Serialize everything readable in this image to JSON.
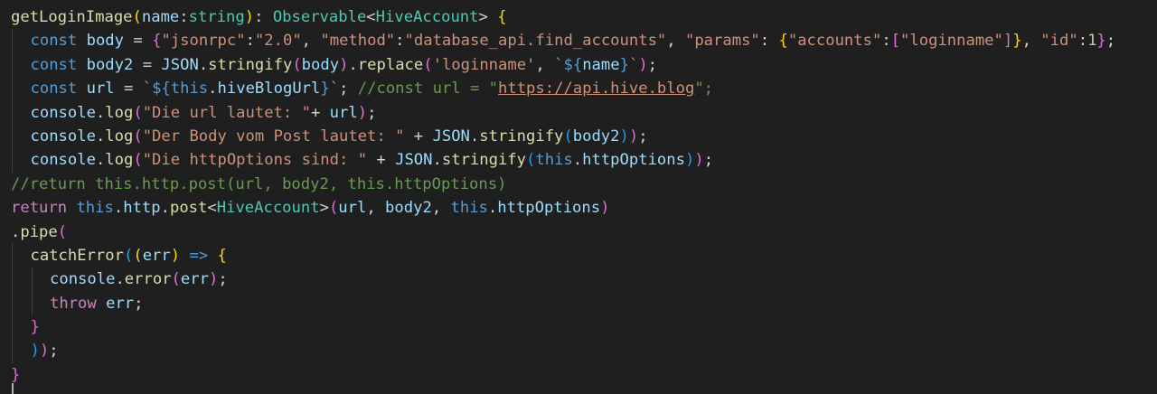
{
  "editor": {
    "language": "TypeScript",
    "theme": "dark",
    "lines": [
      {
        "indent": 0,
        "tokens": [
          {
            "text": "getLoginImage",
            "kind": "function"
          },
          {
            "text": "(",
            "kind": "bracket1"
          },
          {
            "text": "name",
            "kind": "variable"
          },
          {
            "text": ":",
            "kind": "default"
          },
          {
            "text": "string",
            "kind": "type"
          },
          {
            "text": ")",
            "kind": "bracket1"
          },
          {
            "text": ": ",
            "kind": "default"
          },
          {
            "text": "Observable",
            "kind": "type"
          },
          {
            "text": "<",
            "kind": "default"
          },
          {
            "text": "HiveAccount",
            "kind": "type"
          },
          {
            "text": "> ",
            "kind": "default"
          },
          {
            "text": "{",
            "kind": "bracket1"
          }
        ]
      },
      {
        "indent": 1,
        "tokens": [
          {
            "text": "const",
            "kind": "keyword"
          },
          {
            "text": " ",
            "kind": "default"
          },
          {
            "text": "body",
            "kind": "variable"
          },
          {
            "text": " = ",
            "kind": "default"
          },
          {
            "text": "{",
            "kind": "bracket2"
          },
          {
            "text": "\"jsonrpc\"",
            "kind": "string"
          },
          {
            "text": ":",
            "kind": "default"
          },
          {
            "text": "\"2.0\"",
            "kind": "string"
          },
          {
            "text": ", ",
            "kind": "default"
          },
          {
            "text": "\"method\"",
            "kind": "string"
          },
          {
            "text": ":",
            "kind": "default"
          },
          {
            "text": "\"database_api.find_accounts\"",
            "kind": "string"
          },
          {
            "text": ", ",
            "kind": "default"
          },
          {
            "text": "\"params\"",
            "kind": "string"
          },
          {
            "text": ": ",
            "kind": "default"
          },
          {
            "text": "{",
            "kind": "bracket1"
          },
          {
            "text": "\"accounts\"",
            "kind": "string"
          },
          {
            "text": ":",
            "kind": "default"
          },
          {
            "text": "[",
            "kind": "bracket2"
          },
          {
            "text": "\"loginname\"",
            "kind": "string"
          },
          {
            "text": "]",
            "kind": "bracket2"
          },
          {
            "text": "}",
            "kind": "bracket1"
          },
          {
            "text": ", ",
            "kind": "default"
          },
          {
            "text": "\"id\"",
            "kind": "string"
          },
          {
            "text": ":",
            "kind": "default"
          },
          {
            "text": "1",
            "kind": "number"
          },
          {
            "text": "}",
            "kind": "bracket2"
          },
          {
            "text": ";",
            "kind": "default"
          }
        ]
      },
      {
        "indent": 1,
        "tokens": [
          {
            "text": "const",
            "kind": "keyword"
          },
          {
            "text": " ",
            "kind": "default"
          },
          {
            "text": "body2",
            "kind": "variable"
          },
          {
            "text": " = ",
            "kind": "default"
          },
          {
            "text": "JSON",
            "kind": "variable"
          },
          {
            "text": ".",
            "kind": "default"
          },
          {
            "text": "stringify",
            "kind": "function"
          },
          {
            "text": "(",
            "kind": "bracket2"
          },
          {
            "text": "body",
            "kind": "variable"
          },
          {
            "text": ")",
            "kind": "bracket2"
          },
          {
            "text": ".",
            "kind": "default"
          },
          {
            "text": "replace",
            "kind": "function"
          },
          {
            "text": "(",
            "kind": "bracket2"
          },
          {
            "text": "'loginname'",
            "kind": "string"
          },
          {
            "text": ", ",
            "kind": "default"
          },
          {
            "text": "`",
            "kind": "string"
          },
          {
            "text": "${",
            "kind": "keyword"
          },
          {
            "text": "name",
            "kind": "variable"
          },
          {
            "text": "}",
            "kind": "keyword"
          },
          {
            "text": "`",
            "kind": "string"
          },
          {
            "text": ")",
            "kind": "bracket2"
          },
          {
            "text": ";",
            "kind": "default"
          }
        ]
      },
      {
        "indent": 1,
        "tokens": [
          {
            "text": "const",
            "kind": "keyword"
          },
          {
            "text": " ",
            "kind": "default"
          },
          {
            "text": "url",
            "kind": "variable"
          },
          {
            "text": " = ",
            "kind": "default"
          },
          {
            "text": "`",
            "kind": "string"
          },
          {
            "text": "${",
            "kind": "keyword"
          },
          {
            "text": "this",
            "kind": "keyword"
          },
          {
            "text": ".",
            "kind": "default"
          },
          {
            "text": "hiveBlogUrl",
            "kind": "variable"
          },
          {
            "text": "}",
            "kind": "keyword"
          },
          {
            "text": "`",
            "kind": "string"
          },
          {
            "text": "; ",
            "kind": "default"
          },
          {
            "text": "//const url = \"",
            "kind": "comment"
          },
          {
            "text": "https://api.hive.blog",
            "kind": "link"
          },
          {
            "text": "\";",
            "kind": "comment"
          }
        ]
      },
      {
        "indent": 1,
        "tokens": [
          {
            "text": "console",
            "kind": "variable"
          },
          {
            "text": ".",
            "kind": "default"
          },
          {
            "text": "log",
            "kind": "function"
          },
          {
            "text": "(",
            "kind": "bracket2"
          },
          {
            "text": "\"Die url lautet: \"",
            "kind": "string"
          },
          {
            "text": "+ ",
            "kind": "default"
          },
          {
            "text": "url",
            "kind": "variable"
          },
          {
            "text": ")",
            "kind": "bracket2"
          },
          {
            "text": ";",
            "kind": "default"
          }
        ]
      },
      {
        "indent": 1,
        "tokens": [
          {
            "text": "console",
            "kind": "variable"
          },
          {
            "text": ".",
            "kind": "default"
          },
          {
            "text": "log",
            "kind": "function"
          },
          {
            "text": "(",
            "kind": "bracket2"
          },
          {
            "text": "\"Der Body vom Post lautet: \"",
            "kind": "string"
          },
          {
            "text": " + ",
            "kind": "default"
          },
          {
            "text": "JSON",
            "kind": "variable"
          },
          {
            "text": ".",
            "kind": "default"
          },
          {
            "text": "stringify",
            "kind": "function"
          },
          {
            "text": "(",
            "kind": "bracket3"
          },
          {
            "text": "body2",
            "kind": "variable"
          },
          {
            "text": ")",
            "kind": "bracket3"
          },
          {
            "text": ")",
            "kind": "bracket2"
          },
          {
            "text": ";",
            "kind": "default"
          }
        ]
      },
      {
        "indent": 1,
        "tokens": [
          {
            "text": "console",
            "kind": "variable"
          },
          {
            "text": ".",
            "kind": "default"
          },
          {
            "text": "log",
            "kind": "function"
          },
          {
            "text": "(",
            "kind": "bracket2"
          },
          {
            "text": "\"Die httpOptions sind: \"",
            "kind": "string"
          },
          {
            "text": " + ",
            "kind": "default"
          },
          {
            "text": "JSON",
            "kind": "variable"
          },
          {
            "text": ".",
            "kind": "default"
          },
          {
            "text": "stringify",
            "kind": "function"
          },
          {
            "text": "(",
            "kind": "bracket3"
          },
          {
            "text": "this",
            "kind": "keyword"
          },
          {
            "text": ".",
            "kind": "default"
          },
          {
            "text": "httpOptions",
            "kind": "variable"
          },
          {
            "text": ")",
            "kind": "bracket3"
          },
          {
            "text": ")",
            "kind": "bracket2"
          },
          {
            "text": ";",
            "kind": "default"
          }
        ]
      },
      {
        "indent": 0,
        "tokens": [
          {
            "text": "//return this.http.post(url, body2, this.httpOptions)",
            "kind": "comment"
          }
        ]
      },
      {
        "indent": 0,
        "tokens": [
          {
            "text": "return",
            "kind": "control"
          },
          {
            "text": " ",
            "kind": "default"
          },
          {
            "text": "this",
            "kind": "keyword"
          },
          {
            "text": ".",
            "kind": "default"
          },
          {
            "text": "http",
            "kind": "variable"
          },
          {
            "text": ".",
            "kind": "default"
          },
          {
            "text": "post",
            "kind": "function"
          },
          {
            "text": "<",
            "kind": "default"
          },
          {
            "text": "HiveAccount",
            "kind": "type"
          },
          {
            "text": ">",
            "kind": "default"
          },
          {
            "text": "(",
            "kind": "bracket2"
          },
          {
            "text": "url",
            "kind": "variable"
          },
          {
            "text": ", ",
            "kind": "default"
          },
          {
            "text": "body2",
            "kind": "variable"
          },
          {
            "text": ", ",
            "kind": "default"
          },
          {
            "text": "this",
            "kind": "keyword"
          },
          {
            "text": ".",
            "kind": "default"
          },
          {
            "text": "httpOptions",
            "kind": "variable"
          },
          {
            "text": ")",
            "kind": "bracket2"
          }
        ]
      },
      {
        "indent": 0,
        "tokens": [
          {
            "text": ".",
            "kind": "default"
          },
          {
            "text": "pipe",
            "kind": "function"
          },
          {
            "text": "(",
            "kind": "bracket2"
          }
        ]
      },
      {
        "indent": 1,
        "tokens": [
          {
            "text": "catchError",
            "kind": "function"
          },
          {
            "text": "(",
            "kind": "bracket3"
          },
          {
            "text": "(",
            "kind": "bracket1"
          },
          {
            "text": "err",
            "kind": "variable"
          },
          {
            "text": ")",
            "kind": "bracket1"
          },
          {
            "text": " ",
            "kind": "default"
          },
          {
            "text": "=>",
            "kind": "keyword"
          },
          {
            "text": " ",
            "kind": "default"
          },
          {
            "text": "{",
            "kind": "bracket1"
          }
        ]
      },
      {
        "indent": 2,
        "tokens": [
          {
            "text": "console",
            "kind": "variable"
          },
          {
            "text": ".",
            "kind": "default"
          },
          {
            "text": "error",
            "kind": "function"
          },
          {
            "text": "(",
            "kind": "bracket2"
          },
          {
            "text": "err",
            "kind": "variable"
          },
          {
            "text": ")",
            "kind": "bracket2"
          },
          {
            "text": ";",
            "kind": "default"
          }
        ]
      },
      {
        "indent": 2,
        "tokens": [
          {
            "text": "throw",
            "kind": "control"
          },
          {
            "text": " ",
            "kind": "default"
          },
          {
            "text": "err",
            "kind": "variable"
          },
          {
            "text": ";",
            "kind": "default"
          }
        ]
      },
      {
        "indent": 1,
        "tokens": [
          {
            "text": "}",
            "kind": "bracket2"
          }
        ]
      },
      {
        "indent": 1,
        "tokens": [
          {
            "text": ")",
            "kind": "bracket3"
          },
          {
            "text": ")",
            "kind": "bracket2"
          },
          {
            "text": ";",
            "kind": "default"
          }
        ]
      },
      {
        "indent": 0,
        "tokens": [
          {
            "text": "}",
            "kind": "bracket2"
          }
        ]
      }
    ]
  },
  "colors": {
    "background": "#1f1f1f",
    "default": "#d4d4d4",
    "function": "#dcdcaa",
    "variable": "#9cdcfe",
    "type": "#4ec9b0",
    "keyword": "#569cd6",
    "control": "#c586c0",
    "string": "#ce9178",
    "number": "#b5cea8",
    "comment": "#6a9955",
    "bracket1": "#ffd700",
    "bracket2": "#da70d6",
    "bracket3": "#179fff",
    "indent_guide": "#404040"
  }
}
